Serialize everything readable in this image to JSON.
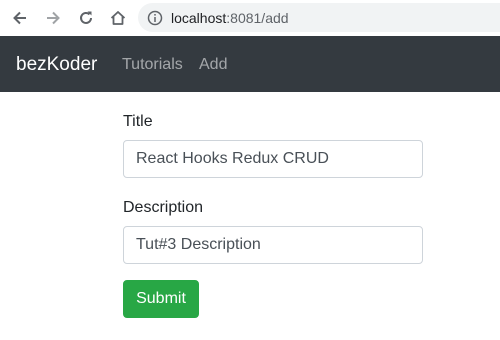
{
  "browser": {
    "url_host": "localhost",
    "url_path": ":8081/add",
    "icons": [
      "back-arrow-icon",
      "forward-arrow-icon",
      "reload-icon",
      "home-icon",
      "info-icon"
    ]
  },
  "navbar": {
    "brand": "bezKoder",
    "links": [
      {
        "label": "Tutorials"
      },
      {
        "label": "Add"
      }
    ],
    "background": "#343a40"
  },
  "form": {
    "title_label": "Title",
    "title_value": "React Hooks Redux CRUD",
    "description_label": "Description",
    "description_value": "Tut#3 Description",
    "submit_label": "Submit",
    "submit_color": "#28a745"
  }
}
